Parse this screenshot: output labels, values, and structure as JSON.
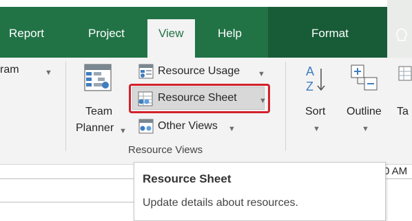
{
  "tabs": {
    "report": "Report",
    "project": "Project",
    "view": "View",
    "help": "Help",
    "format": "Format"
  },
  "ribbon": {
    "gantt_partial": "ram",
    "team_planner_line1": "Team",
    "team_planner_line2": "Planner",
    "resource_usage": "Resource Usage",
    "resource_sheet": "Resource Sheet",
    "other_views": "Other Views",
    "group_resource_views": "Resource Views",
    "sort": "Sort",
    "outline": "Outline",
    "tables_partial": "Ta"
  },
  "timeline": {
    "time_partial": "0 AM"
  },
  "tooltip": {
    "title": "Resource Sheet",
    "description": "Update details about resources."
  },
  "colors": {
    "ribbon_green": "#217346",
    "contextual_tab_dark": "#185c37",
    "highlight_border_red": "#d3212a"
  }
}
